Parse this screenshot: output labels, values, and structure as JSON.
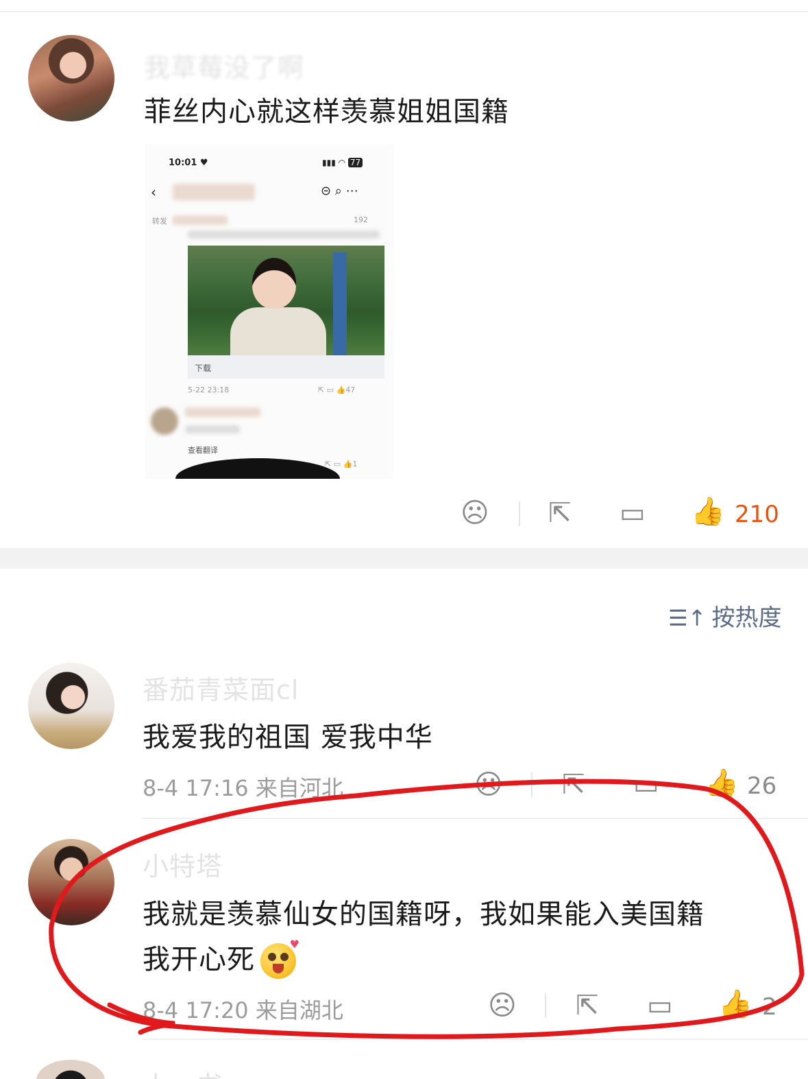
{
  "post": {
    "username": "我草莓没了啊",
    "text": "菲丝内心就这样羡慕姐姐国籍",
    "like_count": "210",
    "embedded_screenshot": {
      "time": "10:01",
      "battery": "77",
      "repost_label": "转发",
      "count_label": "192",
      "download_label": "下载",
      "post_time": "5-22 23:18",
      "post_likes": "47",
      "translate_label": "查看翻译",
      "reply_likes": "1"
    }
  },
  "sort": {
    "label": "按热度",
    "icon": "sort-icon"
  },
  "comments": [
    {
      "username": "番茄青菜面cl",
      "text": "我爱我的祖国 爱我中华",
      "meta": "8-4 17:16 来自河北",
      "like_count": "26"
    },
    {
      "username": "小特塔",
      "text_line1": "我就是羡慕仙女的国籍呀，我如果能入美国籍",
      "text_line2": "我开心死",
      "meta": "8-4 17:20 来自湖北",
      "like_count": "2"
    },
    {
      "username": "小一书"
    }
  ],
  "colors": {
    "accent_like": "#e8520f",
    "annotation": "#e0191c",
    "sort_text": "#5c6c86"
  }
}
